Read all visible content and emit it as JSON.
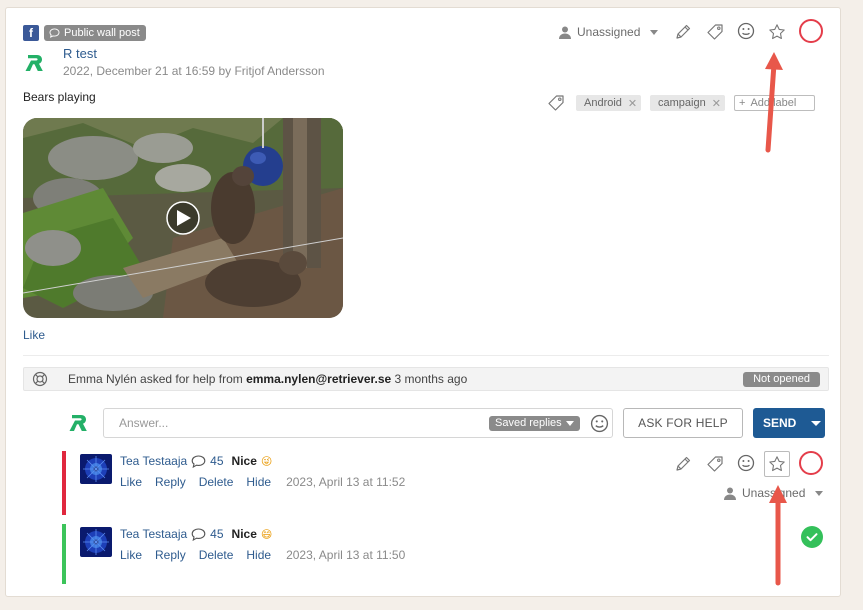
{
  "post": {
    "channel_icon": "facebook-icon",
    "channel_letter": "f",
    "type_label": "Public wall post",
    "author": "R test",
    "meta": "2022, December 21 at 16:59 by Fritjof Andersson",
    "assignee": "Unassigned",
    "text": "Bears playing",
    "labels": [
      "Android",
      "campaign"
    ],
    "add_label_placeholder": "Add label",
    "like_label": "Like",
    "status_color": "#e43d4a"
  },
  "help_request": {
    "prefix": "Emma Nylén asked for help from",
    "email": "emma.nylen@retriever.se",
    "suffix": "3 months ago",
    "badge": "Not opened"
  },
  "composer": {
    "placeholder": "Answer...",
    "saved_replies": "Saved replies",
    "ask_for_help": "ASK FOR HELP",
    "send": "SEND"
  },
  "comments": [
    {
      "author": "Tea Testaaja",
      "count": "45",
      "text": "Nice",
      "emoji": "😜",
      "actions": [
        "Like",
        "Reply",
        "Delete",
        "Hide"
      ],
      "date": "2023, April 13 at 11:52",
      "assignee": "Unassigned",
      "bar_color": "#e0273e",
      "status": "open"
    },
    {
      "author": "Tea Testaaja",
      "count": "45",
      "text": "Nice",
      "emoji": "😄",
      "actions": [
        "Like",
        "Reply",
        "Delete",
        "Hide"
      ],
      "date": "2023, April 13 at 11:50",
      "bar_color": "#3cc45a",
      "status": "done"
    }
  ],
  "colors": {
    "accent_blue": "#1e5a94",
    "link_blue": "#2e5b8e",
    "annotation_arrow": "#e8574a"
  }
}
